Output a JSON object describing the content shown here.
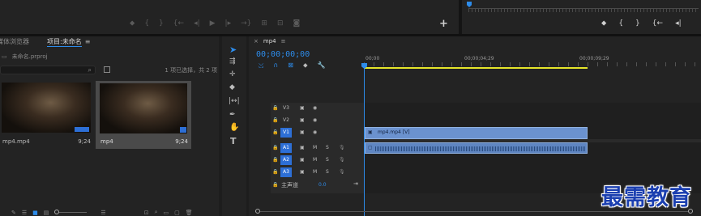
{
  "source_monitor": {
    "transport_icons": [
      "marker-icon",
      "mark-in-icon",
      "mark-out-icon",
      "go-to-in-icon",
      "step-back-icon",
      "play-icon",
      "step-forward-icon",
      "go-to-out-icon",
      "insert-icon",
      "overwrite-icon",
      "export-frame-icon"
    ],
    "add_button": "+"
  },
  "program_monitor": {
    "transport_icons": [
      "marker-icon",
      "mark-in-icon",
      "mark-out-icon",
      "go-to-in-icon",
      "step-back-icon",
      "play-icon"
    ]
  },
  "project_panel": {
    "tab_media_browser": "媒体浏览器",
    "tab_project": "项目:未命名",
    "file_name": "未命名.prproj",
    "selection_status": "1 项已选择，共 2 项",
    "items": [
      {
        "name": "mp4.mp4",
        "duration": "9;24",
        "selected": false
      },
      {
        "name": "mp4",
        "duration": "9;24",
        "selected": true
      }
    ]
  },
  "timeline": {
    "tab_label": "mp4",
    "timecode": "00;00;00;00",
    "ruler": [
      "00;00",
      "00;00;04;29",
      "00;00;09;29"
    ],
    "video_tracks": [
      "V3",
      "V2",
      "V1"
    ],
    "audio_tracks": [
      "A1",
      "A2",
      "A3"
    ],
    "mute_label": "M",
    "solo_label": "S",
    "master_label": "主声道",
    "master_value": "0.0",
    "clip_label": "mp4.mp4 [V]"
  },
  "watermark": "最需教育",
  "colors": {
    "accent": "#2d8ceb",
    "clip_video": "#6b92cf",
    "clip_audio": "#5f86c2",
    "work_area": "#e5e52a",
    "watermark": "#1b3fb0"
  }
}
